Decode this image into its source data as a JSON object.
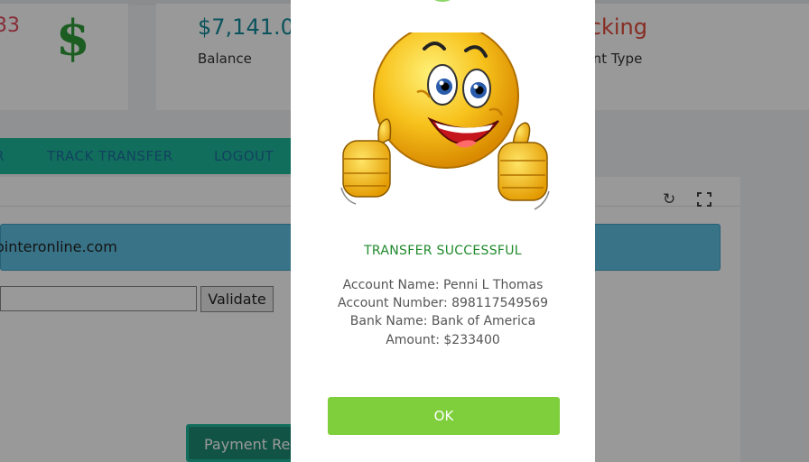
{
  "stats": {
    "card1_value": "33",
    "card2_value": "$7,141.0",
    "card2_label": "Balance",
    "card3_value": "ecking",
    "card3_label": "ount Type"
  },
  "nav": {
    "item_partial": "R",
    "track_transfer": "TRACK TRANSFER",
    "logout": "LOGOUT"
  },
  "panel": {
    "alert_text": "ointeronline.com",
    "validate_label": "Validate",
    "payment_label": "Payment Re"
  },
  "modal": {
    "title": "TRANSFER SUCCESSFUL",
    "account_name": "Account Name: Penni L Thomas",
    "account_number": "Account Number: 898117549569",
    "bank_name": "Bank Name: Bank of America",
    "amount": "Amount: $233400",
    "ok_label": "OK"
  },
  "colors": {
    "nav_bg": "#1fb89a",
    "ok_button": "#7ecf3b",
    "success_text": "#1f8a2c",
    "balance_text": "#138a9c",
    "account_type_text": "#e14a3a"
  },
  "icons": [
    "dollar-icon",
    "refresh-icon",
    "expand-icon",
    "thumbs-up-emoji"
  ]
}
